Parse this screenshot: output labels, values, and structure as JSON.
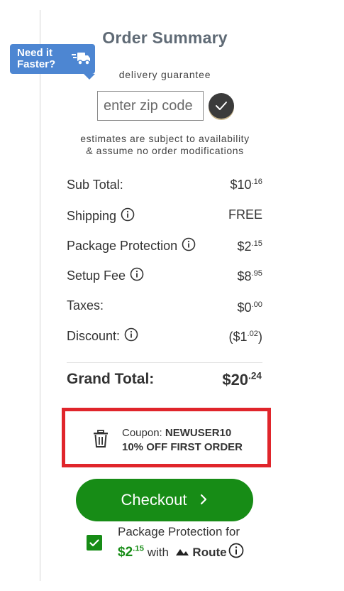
{
  "summary": {
    "title": "Order Summary",
    "badge": {
      "line1": "Need it",
      "line2": "Faster?",
      "icon": "truck-icon"
    },
    "delivery_label": "delivery guarantee",
    "zip": {
      "placeholder": "enter zip code",
      "value": ""
    },
    "disclaimer": {
      "line1": "estimates are subject to availability",
      "line2": "& assume no order modifications"
    }
  },
  "lines": {
    "subtotal": {
      "label": "Sub Total:",
      "whole": "$10",
      "cents": ".16"
    },
    "shipping": {
      "label": "Shipping",
      "value": "FREE"
    },
    "protection": {
      "label": "Package Protection",
      "whole": "$2",
      "cents": ".15"
    },
    "setup": {
      "label": "Setup Fee",
      "whole": "$8",
      "cents": ".95"
    },
    "taxes": {
      "label": "Taxes:",
      "whole": "$0",
      "cents": ".00"
    },
    "discount": {
      "label": "Discount:",
      "open": "($1",
      "cents": ".02",
      "close": ")"
    }
  },
  "grand_total": {
    "label": "Grand Total:",
    "whole": "$20",
    "cents": ".24"
  },
  "coupon": {
    "prefix": "Coupon:",
    "code": "NEWUSER10",
    "description": "10% OFF FIRST ORDER"
  },
  "checkout": {
    "label": "Checkout",
    "chevron": "›"
  },
  "package_protection": {
    "checked": true,
    "line1": "Package Protection for",
    "price_whole": "$2",
    "price_cents": ".15",
    "with": "with",
    "provider": "Route"
  },
  "colors": {
    "accent_green": "#178c16",
    "badge_blue": "#4d86d2",
    "coupon_border": "#e0252b",
    "title_gray": "#5f6a75"
  }
}
